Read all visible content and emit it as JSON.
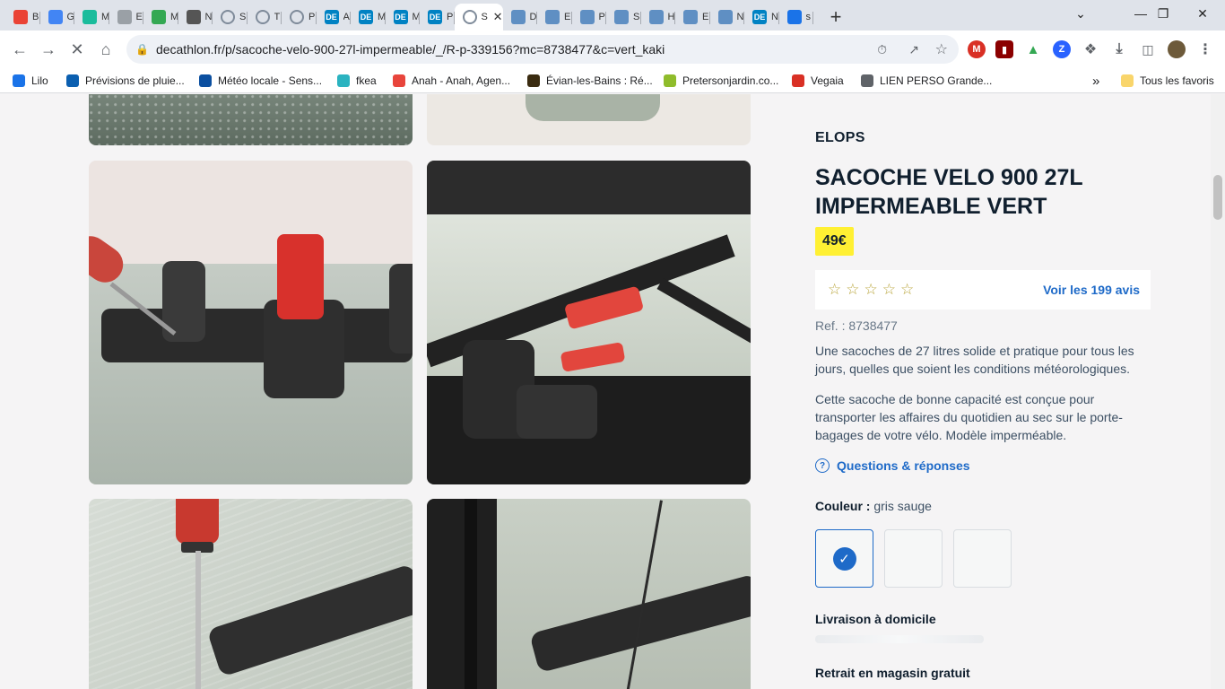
{
  "browser": {
    "tabs": [
      {
        "label": "B",
        "icon": "gmail-icon",
        "color": "#ea4335"
      },
      {
        "label": "G",
        "icon": "calendar-icon",
        "color": "#4285f4"
      },
      {
        "label": "M",
        "icon": "s-icon",
        "color": "#1abc9c"
      },
      {
        "label": "E",
        "icon": "info-icon",
        "color": "#9aa0a6"
      },
      {
        "label": "M",
        "icon": "drive-icon",
        "color": "#34a853"
      },
      {
        "label": "N",
        "icon": "bike-icon",
        "color": "#555555"
      },
      {
        "label": "S",
        "icon": "loading-icon",
        "color": "#7f8b9a"
      },
      {
        "label": "T",
        "icon": "loading-icon",
        "color": "#7f8b9a"
      },
      {
        "label": "P",
        "icon": "loading-icon",
        "color": "#7f8b9a"
      },
      {
        "label": "A",
        "icon": "decathlon-icon",
        "color": "#0082c3"
      },
      {
        "label": "M",
        "icon": "decathlon-icon",
        "color": "#0082c3"
      },
      {
        "label": "M",
        "icon": "decathlon-icon",
        "color": "#0082c3"
      },
      {
        "label": "P",
        "icon": "decathlon-icon",
        "color": "#0082c3"
      },
      {
        "label": "S",
        "icon": "loading-icon",
        "color": "#7f8b9a",
        "active": true
      },
      {
        "label": "D",
        "icon": "c-icon",
        "color": "#5f8fc3"
      },
      {
        "label": "E",
        "icon": "c-icon",
        "color": "#5f8fc3"
      },
      {
        "label": "P",
        "icon": "c-icon",
        "color": "#5f8fc3"
      },
      {
        "label": "S",
        "icon": "c-icon",
        "color": "#5f8fc3"
      },
      {
        "label": "H",
        "icon": "c-icon",
        "color": "#5f8fc3"
      },
      {
        "label": "E",
        "icon": "c-icon",
        "color": "#5f8fc3"
      },
      {
        "label": "N",
        "icon": "c-icon",
        "color": "#5f8fc3"
      },
      {
        "label": "N",
        "icon": "decathlon-icon",
        "color": "#0082c3"
      },
      {
        "label": "s",
        "icon": "drop-icon",
        "color": "#1a73e8"
      }
    ],
    "new_tab": "+",
    "url": "decathlon.fr/p/sacoche-velo-900-27l-impermeable/_/R-p-339156?mc=8738477&c=vert_kaki",
    "bookmarks": [
      {
        "label": "Lilo",
        "color": "#1a73e8"
      },
      {
        "label": "Prévisions de pluie...",
        "color": "#0b5fb0"
      },
      {
        "label": "Météo locale - Sens...",
        "color": "#0b4fa0"
      },
      {
        "label": "fkea",
        "color": "#2bb3c0"
      },
      {
        "label": "Anah - Anah, Agen...",
        "color": "#e8453c"
      },
      {
        "label": "Évian-les-Bains : Ré...",
        "color": "#3a2b10"
      },
      {
        "label": "Pretersonjardin.co...",
        "color": "#8fbc2b"
      },
      {
        "label": "Vegaia",
        "color": "#d93025"
      },
      {
        "label": "LIEN PERSO Grande...",
        "color": "#5f6368"
      }
    ],
    "bookmarks_more": "»",
    "all_bookmarks": "Tous les favoris"
  },
  "product": {
    "brand": "ELOPS",
    "title": "SACOCHE VELO 900 27L IMPERMEABLE VERT",
    "price": "49€",
    "rating_value": 0,
    "rating_max": 5,
    "reviews_link": "Voir les 199 avis",
    "ref": "Ref. : 8738477",
    "description_1": "Une sacoches de 27 litres solide et pratique pour tous les jours, quelles que soient les conditions météorologiques.",
    "description_2": "Cette sacoche de bonne capacité est conçue pour transporter les affaires du quotidien au sec sur le porte-bagages de votre vélo. Modèle imperméable.",
    "qa_link": "Questions & réponses",
    "color_label": "Couleur :",
    "color_value": "gris sauge",
    "delivery_title": "Livraison à domicile",
    "pickup_title": "Retrait en magasin gratuit"
  },
  "colors": {
    "accent": "#1e6ac8",
    "price_bg": "#fff033",
    "text_dark": "#101f2e"
  }
}
